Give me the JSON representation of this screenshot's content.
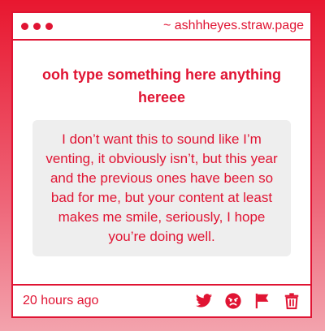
{
  "window": {
    "url": "~ ashhheyes.straw.page"
  },
  "card": {
    "prompt": "ooh type something here anything hereee",
    "message": "I don’t want this to sound like I’m venting, it obviously isn’t, but this year and the previous ones have been so bad for me, but your content at least makes me smile, seriously, I hope you’re doing well.",
    "timestamp": "20 hours ago"
  },
  "actions": [
    {
      "icon": "twitter-icon"
    },
    {
      "icon": "angry-face-icon"
    },
    {
      "icon": "flag-icon"
    },
    {
      "icon": "trash-icon"
    }
  ],
  "colors": {
    "accent": "#e01433",
    "message_bg": "#eeeeee",
    "background_top": "#e8172f",
    "background_bottom": "#f3a3ad"
  }
}
